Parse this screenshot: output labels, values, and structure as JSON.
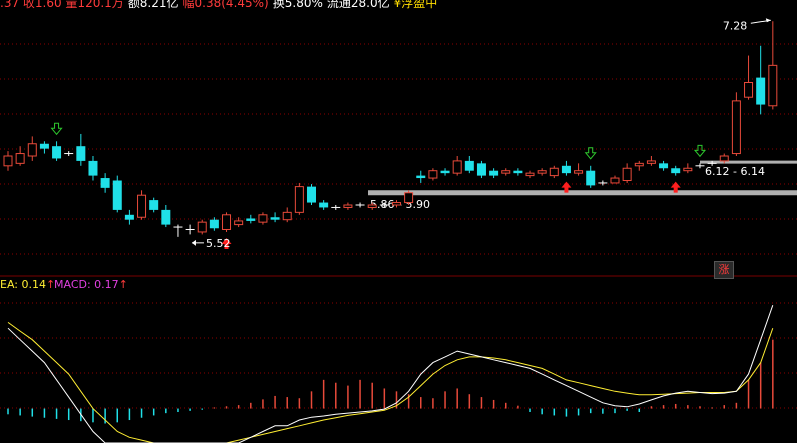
{
  "header": {
    "items": [
      {
        "text": ".37 收1.60 量120.1万",
        "color": "#ff3b3b"
      },
      {
        "text": "额8.21亿",
        "color": "#ffffff"
      },
      {
        "text": "幅0.38(4.45%)",
        "color": "#ff3b3b"
      },
      {
        "text": "换5.80%",
        "color": "#ffffff"
      },
      {
        "text": "流通28.0亿",
        "color": "#ffffff"
      },
      {
        "text": "¥浮盈中",
        "color": "#ffdd00"
      }
    ]
  },
  "indicator": {
    "dea_label": "EA: 0.14",
    "dea_arrow": "↑",
    "macd_label": "MACD: 0.17",
    "macd_arrow": "↑",
    "badge": "涨"
  },
  "colors": {
    "up": "#e84a3a",
    "down": "#20e0e8",
    "grid": "#8b0000",
    "divider": "#7a0000",
    "support": "#b0b0b0",
    "dif": "#ffffff",
    "dea": "#ffee33",
    "buy_arrow": "#ff1e1e",
    "sell_arrow": "#2ec82e",
    "text": "#ffffff"
  },
  "chart_data": [
    {
      "type": "candlestick",
      "price_range": [
        5.38,
        7.38
      ],
      "candles": [
        [
          6.1,
          6.18,
          6.22,
          6.06
        ],
        [
          6.12,
          6.2,
          6.26,
          6.1
        ],
        [
          6.18,
          6.28,
          6.34,
          6.14
        ],
        [
          6.28,
          6.24,
          6.3,
          6.2
        ],
        [
          6.26,
          6.16,
          6.3,
          6.14
        ],
        [
          6.2,
          6.2,
          6.22,
          6.18
        ],
        [
          6.26,
          6.14,
          6.36,
          6.1
        ],
        [
          6.14,
          6.02,
          6.18,
          5.98
        ],
        [
          6.0,
          5.92,
          6.04,
          5.88
        ],
        [
          5.98,
          5.74,
          6.02,
          5.72
        ],
        [
          5.7,
          5.66,
          5.74,
          5.62
        ],
        [
          5.68,
          5.86,
          5.9,
          5.66
        ],
        [
          5.82,
          5.74,
          5.84,
          5.72
        ],
        [
          5.74,
          5.62,
          5.78,
          5.6
        ],
        [
          5.6,
          5.6,
          5.62,
          5.52
        ],
        [
          5.58,
          5.58,
          5.62,
          5.54
        ],
        [
          5.56,
          5.64,
          5.66,
          5.54
        ],
        [
          5.66,
          5.59,
          5.68,
          5.57
        ],
        [
          5.58,
          5.7,
          5.72,
          5.56
        ],
        [
          5.62,
          5.65,
          5.68,
          5.6
        ],
        [
          5.67,
          5.65,
          5.7,
          5.63
        ],
        [
          5.64,
          5.7,
          5.72,
          5.62
        ],
        [
          5.68,
          5.66,
          5.72,
          5.64
        ],
        [
          5.66,
          5.72,
          5.76,
          5.64
        ],
        [
          5.72,
          5.93,
          5.96,
          5.7
        ],
        [
          5.93,
          5.8,
          5.95,
          5.78
        ],
        [
          5.8,
          5.76,
          5.82,
          5.74
        ],
        [
          5.76,
          5.76,
          5.78,
          5.74
        ],
        [
          5.76,
          5.78,
          5.8,
          5.74
        ],
        [
          5.78,
          5.78,
          5.8,
          5.76
        ],
        [
          5.76,
          5.78,
          5.8,
          5.74
        ],
        [
          5.78,
          5.78,
          5.8,
          5.76
        ],
        [
          5.78,
          5.8,
          5.82,
          5.76
        ],
        [
          5.8,
          5.88,
          5.9,
          5.78
        ],
        [
          6.02,
          6.0,
          6.06,
          5.96
        ],
        [
          6.0,
          6.06,
          6.08,
          5.98
        ],
        [
          6.06,
          6.04,
          6.08,
          6.02
        ],
        [
          6.04,
          6.14,
          6.18,
          6.02
        ],
        [
          6.14,
          6.06,
          6.18,
          6.04
        ],
        [
          6.12,
          6.02,
          6.14,
          6.0
        ],
        [
          6.06,
          6.02,
          6.08,
          6.0
        ],
        [
          6.04,
          6.06,
          6.08,
          6.02
        ],
        [
          6.06,
          6.04,
          6.08,
          6.02
        ],
        [
          6.02,
          6.04,
          6.06,
          6.0
        ],
        [
          6.04,
          6.06,
          6.08,
          6.02
        ],
        [
          6.02,
          6.08,
          6.1,
          6.0
        ],
        [
          6.1,
          6.04,
          6.14,
          6.02
        ],
        [
          6.04,
          6.06,
          6.12,
          6.02
        ],
        [
          6.06,
          5.94,
          6.1,
          5.92
        ],
        [
          5.96,
          5.96,
          5.98,
          5.94
        ],
        [
          5.96,
          6.0,
          6.02,
          5.96
        ],
        [
          5.98,
          6.08,
          6.12,
          5.96
        ],
        [
          6.1,
          6.12,
          6.14,
          6.06
        ],
        [
          6.12,
          6.14,
          6.18,
          6.1
        ],
        [
          6.12,
          6.08,
          6.14,
          6.06
        ],
        [
          6.08,
          6.04,
          6.1,
          6.02
        ],
        [
          6.06,
          6.08,
          6.12,
          6.04
        ],
        [
          6.1,
          6.1,
          6.12,
          6.08
        ],
        [
          6.12,
          6.12,
          6.14,
          6.1
        ],
        [
          6.14,
          6.18,
          6.2,
          6.12
        ],
        [
          6.2,
          6.63,
          6.7,
          6.18
        ],
        [
          6.66,
          6.78,
          7.0,
          6.64
        ],
        [
          6.82,
          6.6,
          7.08,
          6.52
        ],
        [
          6.59,
          6.92,
          7.28,
          6.56
        ]
      ],
      "support_zones": [
        {
          "low": 5.86,
          "high": 5.9,
          "label": "5.86 - 5.90"
        },
        {
          "low": 6.12,
          "high": 6.14,
          "label": "6.12 - 6.14"
        }
      ],
      "annotations": [
        {
          "text": "7.28",
          "index": 63,
          "price": 7.28
        },
        {
          "text": "5.52",
          "index": 14,
          "price": 5.52
        }
      ],
      "buy_signals": [
        18,
        46,
        55
      ],
      "sell_signals": [
        4,
        48,
        57
      ]
    },
    {
      "type": "macd",
      "value_range": [
        -0.06,
        0.21
      ],
      "dif": [
        0.14,
        0.12,
        0.1,
        0.08,
        0.05,
        0.02,
        -0.01,
        -0.04,
        -0.06,
        -0.06,
        -0.06,
        -0.06,
        -0.06,
        -0.06,
        -0.06,
        -0.06,
        -0.06,
        -0.06,
        -0.06,
        -0.06,
        -0.05,
        -0.04,
        -0.03,
        -0.03,
        -0.02,
        -0.015,
        -0.013,
        -0.01,
        -0.008,
        -0.006,
        -0.004,
        -0.001,
        0.01,
        0.03,
        0.06,
        0.08,
        0.09,
        0.1,
        0.095,
        0.09,
        0.085,
        0.08,
        0.075,
        0.07,
        0.06,
        0.05,
        0.04,
        0.03,
        0.02,
        0.01,
        0.005,
        0.003,
        0.008,
        0.015,
        0.022,
        0.027,
        0.03,
        0.028,
        0.026,
        0.027,
        0.03,
        0.06,
        0.12,
        0.18
      ],
      "dea": [
        0.15,
        0.135,
        0.12,
        0.1,
        0.08,
        0.06,
        0.03,
        0.0,
        -0.02,
        -0.04,
        -0.05,
        -0.055,
        -0.06,
        -0.06,
        -0.06,
        -0.06,
        -0.06,
        -0.06,
        -0.06,
        -0.055,
        -0.05,
        -0.045,
        -0.04,
        -0.035,
        -0.03,
        -0.025,
        -0.02,
        -0.016,
        -0.012,
        -0.009,
        -0.006,
        -0.003,
        0.005,
        0.02,
        0.04,
        0.06,
        0.075,
        0.085,
        0.09,
        0.09,
        0.088,
        0.085,
        0.08,
        0.075,
        0.07,
        0.06,
        0.05,
        0.045,
        0.04,
        0.035,
        0.03,
        0.027,
        0.024,
        0.024,
        0.025,
        0.026,
        0.027,
        0.028,
        0.028,
        0.028,
        0.03,
        0.05,
        0.08,
        0.14
      ],
      "macd": [
        -0.01,
        -0.012,
        -0.014,
        -0.016,
        -0.018,
        -0.02,
        -0.022,
        -0.024,
        -0.026,
        -0.024,
        -0.02,
        -0.016,
        -0.012,
        -0.008,
        -0.006,
        -0.004,
        -0.002,
        0.002,
        0.004,
        0.006,
        0.01,
        0.016,
        0.022,
        0.02,
        0.018,
        0.03,
        0.05,
        0.045,
        0.04,
        0.05,
        0.045,
        0.035,
        0.03,
        0.025,
        0.02,
        0.018,
        0.03,
        0.035,
        0.025,
        0.02,
        0.015,
        0.01,
        0.005,
        -0.006,
        -0.01,
        -0.012,
        -0.014,
        -0.012,
        -0.008,
        -0.009,
        -0.008,
        -0.004,
        -0.006,
        0.004,
        0.006,
        0.008,
        0.006,
        0.004,
        0.002,
        0.006,
        0.01,
        0.05,
        0.08,
        0.12
      ]
    }
  ]
}
